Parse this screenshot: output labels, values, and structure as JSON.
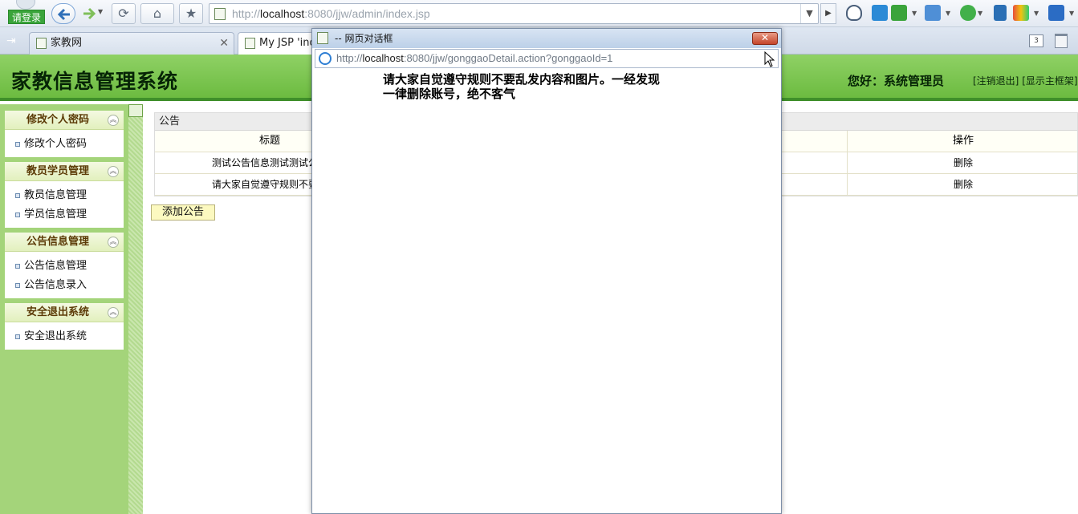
{
  "browser": {
    "login_badge": "请登录",
    "address_url_prefix": "http://",
    "address_url_host": "localhost",
    "address_url_rest": ":8080/jjw/admin/index.jsp",
    "tabs": [
      {
        "label": "家教网",
        "active": false
      },
      {
        "label": "My JSP 'ind",
        "active": true
      }
    ],
    "tab_count": "3"
  },
  "header": {
    "title": "家教信息管理系统",
    "welcome": "您好：系统管理员",
    "logout_link": "[注销退出]",
    "mainframe_link": "[显示主框架]"
  },
  "sidebar": {
    "sections": [
      {
        "title": "修改个人密码",
        "items": [
          "修改个人密码"
        ]
      },
      {
        "title": "教员学员管理",
        "items": [
          "教员信息管理",
          "学员信息管理"
        ]
      },
      {
        "title": "公告信息管理",
        "items": [
          "公告信息管理",
          "公告信息录入"
        ]
      },
      {
        "title": "安全退出系统",
        "items": [
          "安全退出系统"
        ]
      }
    ]
  },
  "notice_table": {
    "caption": "公告",
    "columns": [
      "标题",
      "操作"
    ],
    "rows": [
      {
        "title": "测试公告信息测试测试公告",
        "action": "删除"
      },
      {
        "title": "请大家自觉遵守规则不要乱",
        "action": "删除"
      }
    ],
    "add_button": "添加公告"
  },
  "dialog": {
    "title": "-- 网页对话框",
    "url_prefix": "http://",
    "url_host": "localhost",
    "url_rest": ":8080/jjw/gonggaoDetail.action?gonggaoId=1",
    "content_line1": "请大家自觉遵守规则不要乱发内容和图片。一经发现",
    "content_line2": "一律删除账号，绝不客气"
  },
  "colors": {
    "header_green": "#6cbb40",
    "sidebar_green": "#a4d47a",
    "login_green": "#3aa43b",
    "close_red": "#c4452a"
  }
}
